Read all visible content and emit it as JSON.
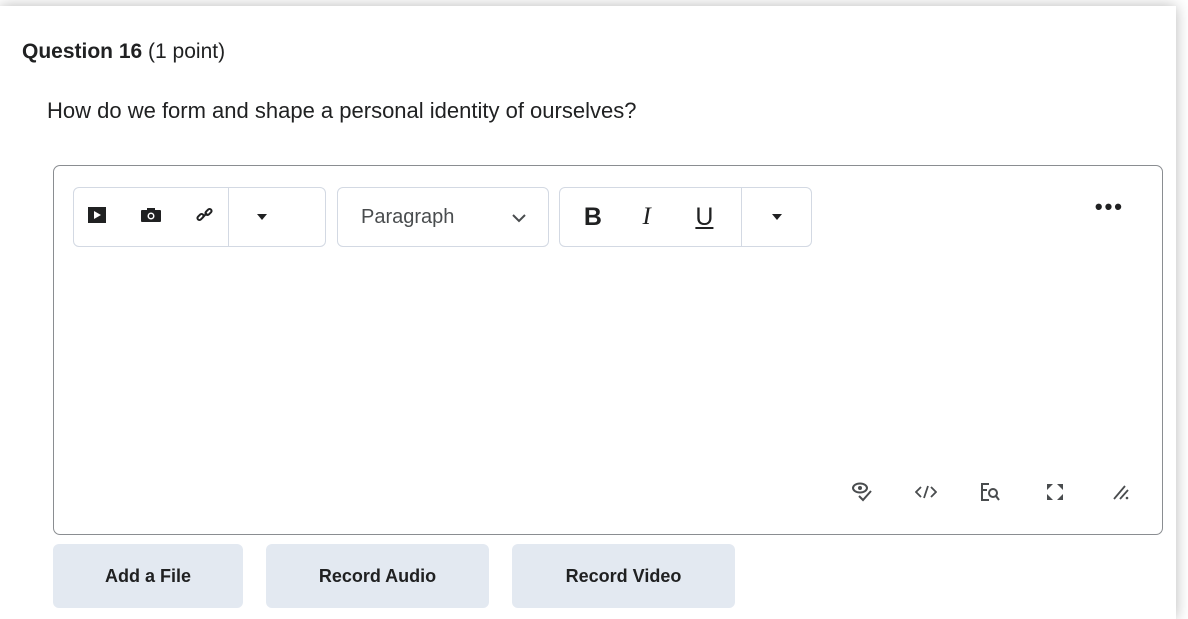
{
  "question": {
    "title": "Question 16",
    "points": "(1 point)",
    "prompt": "How do we form and shape a personal identity of ourselves?"
  },
  "toolbar": {
    "insert_group_icons": [
      "insert-media-icon",
      "insert-image-icon",
      "insert-link-icon",
      "dropdown-arrow-icon"
    ],
    "paragraph_label": "Paragraph",
    "bold_label": "B",
    "italic_label": "I",
    "underline_label": "U",
    "more_label": "•••"
  },
  "editor_footer_icons": [
    "accessibility-check-icon",
    "source-code-icon",
    "preview-icon",
    "fullscreen-icon",
    "resize-handle-icon"
  ],
  "actions": {
    "add_file": "Add a File",
    "record_audio": "Record Audio",
    "record_video": "Record Video"
  },
  "colors": {
    "button_bg": "#e3e9f1",
    "border": "#8a8d91",
    "toolbar_border": "#d3d9e3",
    "text": "#202122"
  }
}
